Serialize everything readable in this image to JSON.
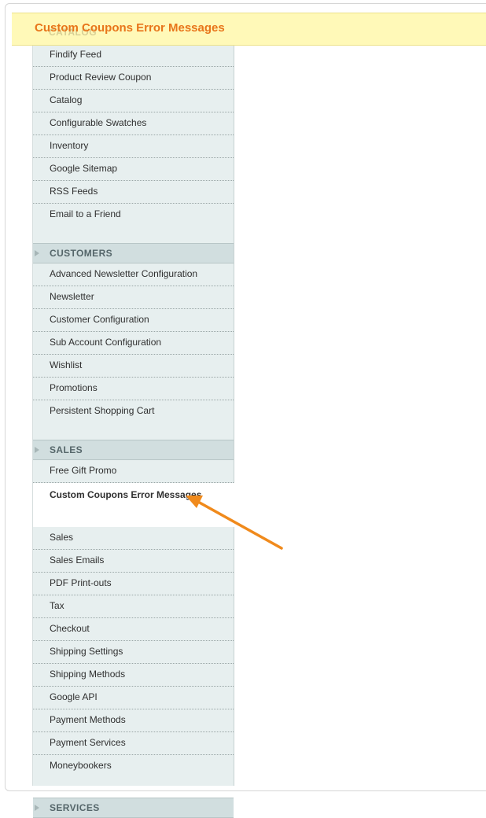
{
  "banner": {
    "title": "Custom Coupons Error Messages",
    "ghost_section": "CATALOG"
  },
  "catalog_items": [
    {
      "label": "Findify Feed"
    },
    {
      "label": "Product Review Coupon"
    },
    {
      "label": "Catalog"
    },
    {
      "label": "Configurable Swatches"
    },
    {
      "label": "Inventory"
    },
    {
      "label": "Google Sitemap"
    },
    {
      "label": "RSS Feeds"
    },
    {
      "label": "Email to a Friend"
    }
  ],
  "customers": {
    "title": "CUSTOMERS",
    "items": [
      {
        "label": "Advanced Newsletter Configuration"
      },
      {
        "label": "Newsletter"
      },
      {
        "label": "Customer Configuration"
      },
      {
        "label": "Sub Account Configuration"
      },
      {
        "label": "Wishlist"
      },
      {
        "label": "Promotions"
      },
      {
        "label": "Persistent Shopping Cart"
      }
    ]
  },
  "sales": {
    "title": "SALES",
    "items": [
      {
        "label": "Free Gift Promo"
      },
      {
        "label": "Custom Coupons Error Messages",
        "active": true
      },
      {
        "label": "Sales"
      },
      {
        "label": "Sales Emails"
      },
      {
        "label": "PDF Print-outs"
      },
      {
        "label": "Tax"
      },
      {
        "label": "Checkout"
      },
      {
        "label": "Shipping Settings"
      },
      {
        "label": "Shipping Methods"
      },
      {
        "label": "Google API"
      },
      {
        "label": "Payment Methods"
      },
      {
        "label": "Payment Services"
      },
      {
        "label": "Moneybookers"
      }
    ]
  },
  "services": {
    "title": "SERVICES"
  },
  "colors": {
    "accent": "#e8751a",
    "banner_bg": "#fff9b8",
    "sidebar_bg": "#e7efef",
    "section_bg": "#d1dedf"
  },
  "annotation": {
    "icon": "arrow-icon"
  }
}
